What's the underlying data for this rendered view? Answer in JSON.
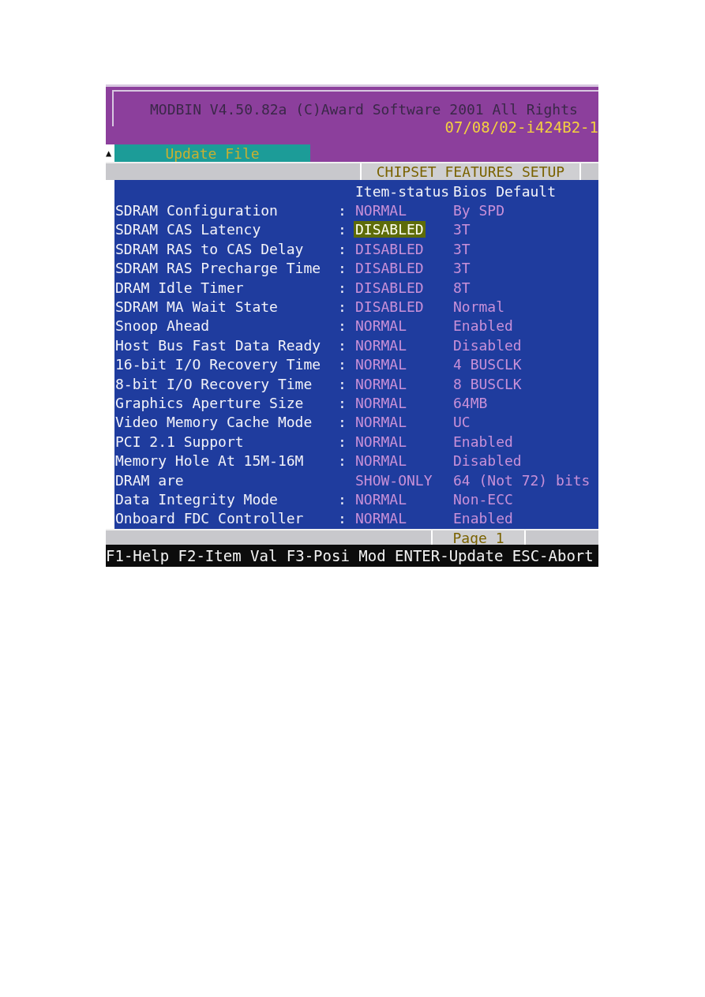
{
  "header": {
    "title": "MODBIN V4.50.82a (C)Award Software 2001 All Rights",
    "date": "07/08/02-i424B2-1"
  },
  "scroll_marker": "▲",
  "tab": {
    "label": "Update File",
    "selected": true
  },
  "section_title": "CHIPSET FEATURES SETUP",
  "columns": [
    "Item-status",
    "Bios Default"
  ],
  "rows": [
    {
      "label": "SDRAM Configuration",
      "separator": ":",
      "status": "NORMAL",
      "default": "By SPD",
      "selected": false
    },
    {
      "label": "SDRAM CAS Latency",
      "separator": ":",
      "status": "DISABLED",
      "default": "3T",
      "selected": true
    },
    {
      "label": "SDRAM RAS to CAS Delay",
      "separator": ":",
      "status": "DISABLED",
      "default": "3T",
      "selected": false
    },
    {
      "label": "SDRAM RAS Precharge Time",
      "separator": ":",
      "status": "DISABLED",
      "default": "3T",
      "selected": false
    },
    {
      "label": "DRAM Idle Timer",
      "separator": ":",
      "status": "DISABLED",
      "default": "8T",
      "selected": false
    },
    {
      "label": "SDRAM MA Wait State",
      "separator": ":",
      "status": "DISABLED",
      "default": "Normal",
      "selected": false
    },
    {
      "label": "Snoop Ahead",
      "separator": ":",
      "status": "NORMAL",
      "default": "Enabled",
      "selected": false
    },
    {
      "label": "Host Bus Fast Data Ready",
      "separator": ":",
      "status": "NORMAL",
      "default": "Disabled",
      "selected": false
    },
    {
      "label": "16-bit I/O Recovery Time",
      "separator": ":",
      "status": "NORMAL",
      "default": "4 BUSCLK",
      "selected": false
    },
    {
      "label": "8-bit I/O Recovery Time",
      "separator": ":",
      "status": "NORMAL",
      "default": "8 BUSCLK",
      "selected": false
    },
    {
      "label": "Graphics Aperture Size",
      "separator": ":",
      "status": "NORMAL",
      "default": "64MB",
      "selected": false
    },
    {
      "label": "Video Memory Cache Mode",
      "separator": ":",
      "status": "NORMAL",
      "default": "UC",
      "selected": false
    },
    {
      "label": "PCI 2.1 Support",
      "separator": ":",
      "status": "NORMAL",
      "default": "Enabled",
      "selected": false
    },
    {
      "label": "Memory Hole At 15M-16M",
      "separator": ":",
      "status": "NORMAL",
      "default": "Disabled",
      "selected": false
    },
    {
      "label": "DRAM are",
      "status": "SHOW-ONLY",
      "default": "64 (Not 72) bits",
      "selected": false
    },
    {
      "label": "Data Integrity Mode",
      "separator": ":",
      "status": "NORMAL",
      "default": "Non-ECC",
      "selected": false
    },
    {
      "label": "Onboard FDC Controller",
      "separator": ":",
      "status": "NORMAL",
      "default": "Enabled",
      "selected": false
    }
  ],
  "page_indicator": "Page 1",
  "status_bar": "F1-Help F2-Item Val F3-Posi Mod ENTER-Update ESC-Abort"
}
